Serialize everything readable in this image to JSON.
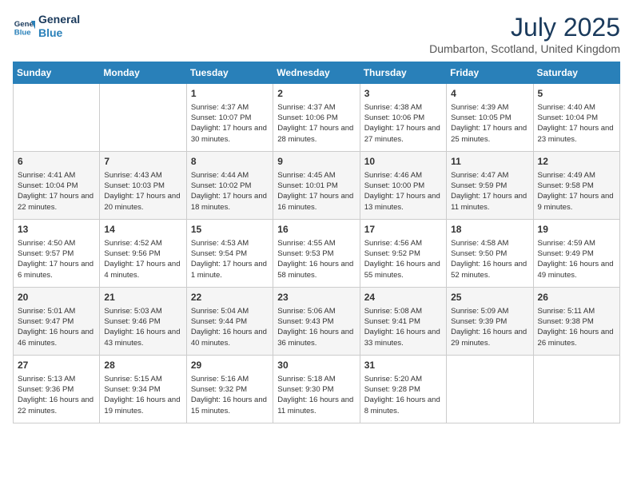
{
  "header": {
    "logo_line1": "General",
    "logo_line2": "Blue",
    "month_title": "July 2025",
    "location": "Dumbarton, Scotland, United Kingdom"
  },
  "weekdays": [
    "Sunday",
    "Monday",
    "Tuesday",
    "Wednesday",
    "Thursday",
    "Friday",
    "Saturday"
  ],
  "weeks": [
    [
      {
        "day": "",
        "info": ""
      },
      {
        "day": "",
        "info": ""
      },
      {
        "day": "1",
        "info": "Sunrise: 4:37 AM\nSunset: 10:07 PM\nDaylight: 17 hours and 30 minutes."
      },
      {
        "day": "2",
        "info": "Sunrise: 4:37 AM\nSunset: 10:06 PM\nDaylight: 17 hours and 28 minutes."
      },
      {
        "day": "3",
        "info": "Sunrise: 4:38 AM\nSunset: 10:06 PM\nDaylight: 17 hours and 27 minutes."
      },
      {
        "day": "4",
        "info": "Sunrise: 4:39 AM\nSunset: 10:05 PM\nDaylight: 17 hours and 25 minutes."
      },
      {
        "day": "5",
        "info": "Sunrise: 4:40 AM\nSunset: 10:04 PM\nDaylight: 17 hours and 23 minutes."
      }
    ],
    [
      {
        "day": "6",
        "info": "Sunrise: 4:41 AM\nSunset: 10:04 PM\nDaylight: 17 hours and 22 minutes."
      },
      {
        "day": "7",
        "info": "Sunrise: 4:43 AM\nSunset: 10:03 PM\nDaylight: 17 hours and 20 minutes."
      },
      {
        "day": "8",
        "info": "Sunrise: 4:44 AM\nSunset: 10:02 PM\nDaylight: 17 hours and 18 minutes."
      },
      {
        "day": "9",
        "info": "Sunrise: 4:45 AM\nSunset: 10:01 PM\nDaylight: 17 hours and 16 minutes."
      },
      {
        "day": "10",
        "info": "Sunrise: 4:46 AM\nSunset: 10:00 PM\nDaylight: 17 hours and 13 minutes."
      },
      {
        "day": "11",
        "info": "Sunrise: 4:47 AM\nSunset: 9:59 PM\nDaylight: 17 hours and 11 minutes."
      },
      {
        "day": "12",
        "info": "Sunrise: 4:49 AM\nSunset: 9:58 PM\nDaylight: 17 hours and 9 minutes."
      }
    ],
    [
      {
        "day": "13",
        "info": "Sunrise: 4:50 AM\nSunset: 9:57 PM\nDaylight: 17 hours and 6 minutes."
      },
      {
        "day": "14",
        "info": "Sunrise: 4:52 AM\nSunset: 9:56 PM\nDaylight: 17 hours and 4 minutes."
      },
      {
        "day": "15",
        "info": "Sunrise: 4:53 AM\nSunset: 9:54 PM\nDaylight: 17 hours and 1 minute."
      },
      {
        "day": "16",
        "info": "Sunrise: 4:55 AM\nSunset: 9:53 PM\nDaylight: 16 hours and 58 minutes."
      },
      {
        "day": "17",
        "info": "Sunrise: 4:56 AM\nSunset: 9:52 PM\nDaylight: 16 hours and 55 minutes."
      },
      {
        "day": "18",
        "info": "Sunrise: 4:58 AM\nSunset: 9:50 PM\nDaylight: 16 hours and 52 minutes."
      },
      {
        "day": "19",
        "info": "Sunrise: 4:59 AM\nSunset: 9:49 PM\nDaylight: 16 hours and 49 minutes."
      }
    ],
    [
      {
        "day": "20",
        "info": "Sunrise: 5:01 AM\nSunset: 9:47 PM\nDaylight: 16 hours and 46 minutes."
      },
      {
        "day": "21",
        "info": "Sunrise: 5:03 AM\nSunset: 9:46 PM\nDaylight: 16 hours and 43 minutes."
      },
      {
        "day": "22",
        "info": "Sunrise: 5:04 AM\nSunset: 9:44 PM\nDaylight: 16 hours and 40 minutes."
      },
      {
        "day": "23",
        "info": "Sunrise: 5:06 AM\nSunset: 9:43 PM\nDaylight: 16 hours and 36 minutes."
      },
      {
        "day": "24",
        "info": "Sunrise: 5:08 AM\nSunset: 9:41 PM\nDaylight: 16 hours and 33 minutes."
      },
      {
        "day": "25",
        "info": "Sunrise: 5:09 AM\nSunset: 9:39 PM\nDaylight: 16 hours and 29 minutes."
      },
      {
        "day": "26",
        "info": "Sunrise: 5:11 AM\nSunset: 9:38 PM\nDaylight: 16 hours and 26 minutes."
      }
    ],
    [
      {
        "day": "27",
        "info": "Sunrise: 5:13 AM\nSunset: 9:36 PM\nDaylight: 16 hours and 22 minutes."
      },
      {
        "day": "28",
        "info": "Sunrise: 5:15 AM\nSunset: 9:34 PM\nDaylight: 16 hours and 19 minutes."
      },
      {
        "day": "29",
        "info": "Sunrise: 5:16 AM\nSunset: 9:32 PM\nDaylight: 16 hours and 15 minutes."
      },
      {
        "day": "30",
        "info": "Sunrise: 5:18 AM\nSunset: 9:30 PM\nDaylight: 16 hours and 11 minutes."
      },
      {
        "day": "31",
        "info": "Sunrise: 5:20 AM\nSunset: 9:28 PM\nDaylight: 16 hours and 8 minutes."
      },
      {
        "day": "",
        "info": ""
      },
      {
        "day": "",
        "info": ""
      }
    ]
  ]
}
